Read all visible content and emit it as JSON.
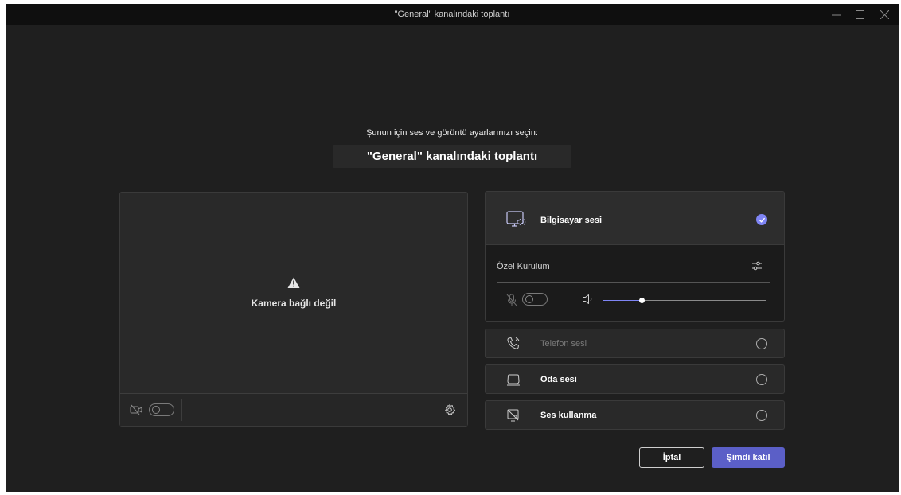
{
  "window": {
    "title": "\"General\" kanalındaki toplantı"
  },
  "prejoin": {
    "subtitle": "Şunun için ses ve görüntü ayarlarınızı seçin:",
    "meeting_title": "\"General\" kanalındaki toplantı"
  },
  "video": {
    "camera_status": "Kamera bağlı değil",
    "camera_toggle_on": false
  },
  "audio": {
    "computer": {
      "label": "Bilgisayar sesi",
      "selected": true,
      "custom_setup_label": "Özel Kurulum",
      "mic_toggle_on": false,
      "speaker_volume": 0.24
    },
    "phone": {
      "label": "Telefon sesi",
      "selected": false
    },
    "room": {
      "label": "Oda sesi",
      "selected": false
    },
    "none": {
      "label": "Ses kullanma",
      "selected": false
    }
  },
  "actions": {
    "cancel_label": "İptal",
    "join_label": "Şimdi katıl"
  },
  "colors": {
    "accent": "#5b5fc7",
    "check": "#7f85f5",
    "background": "#1f1f1f",
    "titlebar": "#0f0f0f"
  }
}
